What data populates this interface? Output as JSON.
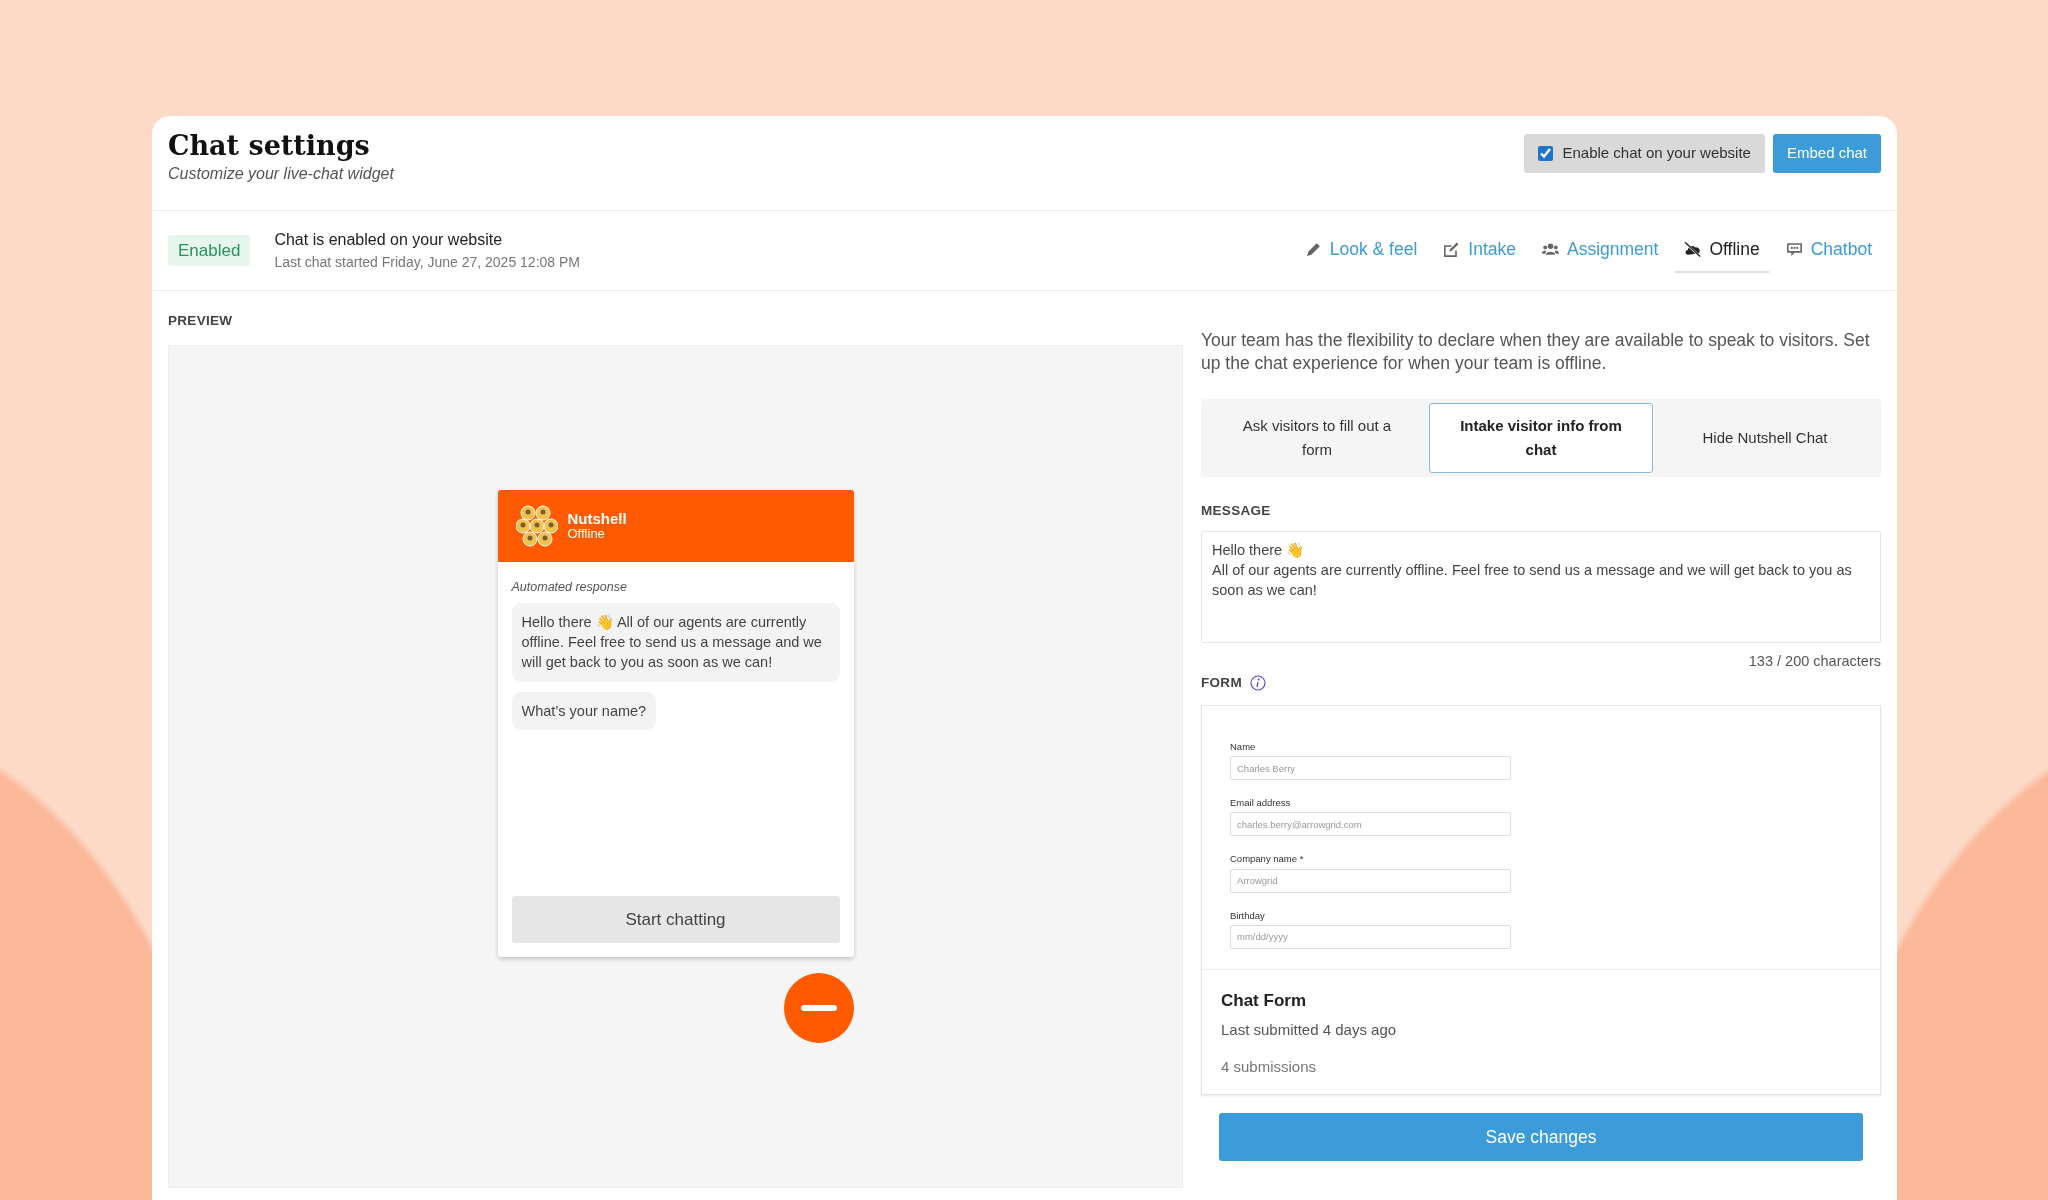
{
  "header": {
    "title": "Chat settings",
    "subtitle": "Customize your live-chat widget",
    "enable_checkbox": {
      "label": "Enable chat on your website",
      "checked": true
    },
    "embed_button": "Embed chat"
  },
  "status": {
    "badge": "Enabled",
    "message": "Chat is enabled on your website",
    "detail": "Last chat started Friday, June 27, 2025 12:08 PM"
  },
  "tabs": [
    {
      "label": "Look & feel",
      "kind": "pencil",
      "selected": false
    },
    {
      "label": "Intake",
      "kind": "edit",
      "selected": false
    },
    {
      "label": "Assignment",
      "kind": "people",
      "selected": false
    },
    {
      "label": "Offline",
      "kind": "cloudoff",
      "selected": true
    },
    {
      "label": "Chatbot",
      "kind": "chat",
      "selected": false
    }
  ],
  "preview": {
    "label": "PREVIEW",
    "widget": {
      "name": "Nutshell",
      "status": "Offline",
      "note": "Automated response",
      "bubbles": [
        "Hello there 👋 All of our agents are currently offline. Feel free to send us a message and we will get back to you as soon as we can!",
        "What’s your name?"
      ],
      "start_button": "Start chatting"
    }
  },
  "offline": {
    "intro": "Your team has the flexibility to declare when they are available to speak to visitors. Set up the chat experience for when your team is offline.",
    "options": [
      {
        "label": "Ask visitors to fill out a form",
        "selected": false
      },
      {
        "label": "Intake visitor info from chat",
        "selected": true
      },
      {
        "label": "Hide Nutshell Chat",
        "selected": false
      }
    ],
    "message_label": "MESSAGE",
    "message": "Hello there 👋\nAll of our agents are currently offline. Feel free to send us a message and we will get back to you as soon as we can!",
    "char_count": "133 / 200 characters",
    "form_label": "FORM",
    "form_fields": [
      {
        "label": "Name",
        "placeholder": "Charles Berry"
      },
      {
        "label": "Email address",
        "placeholder": "charles.berry@arrowgrid.com"
      },
      {
        "label": "Company name *",
        "placeholder": "Arrowgrid"
      },
      {
        "label": "Birthday",
        "placeholder": "mm/dd/yyyy"
      }
    ],
    "form_title": "Chat Form",
    "last_submitted": "Last submitted 4 days ago",
    "submissions": "4 submissions",
    "save_button": "Save changes"
  }
}
